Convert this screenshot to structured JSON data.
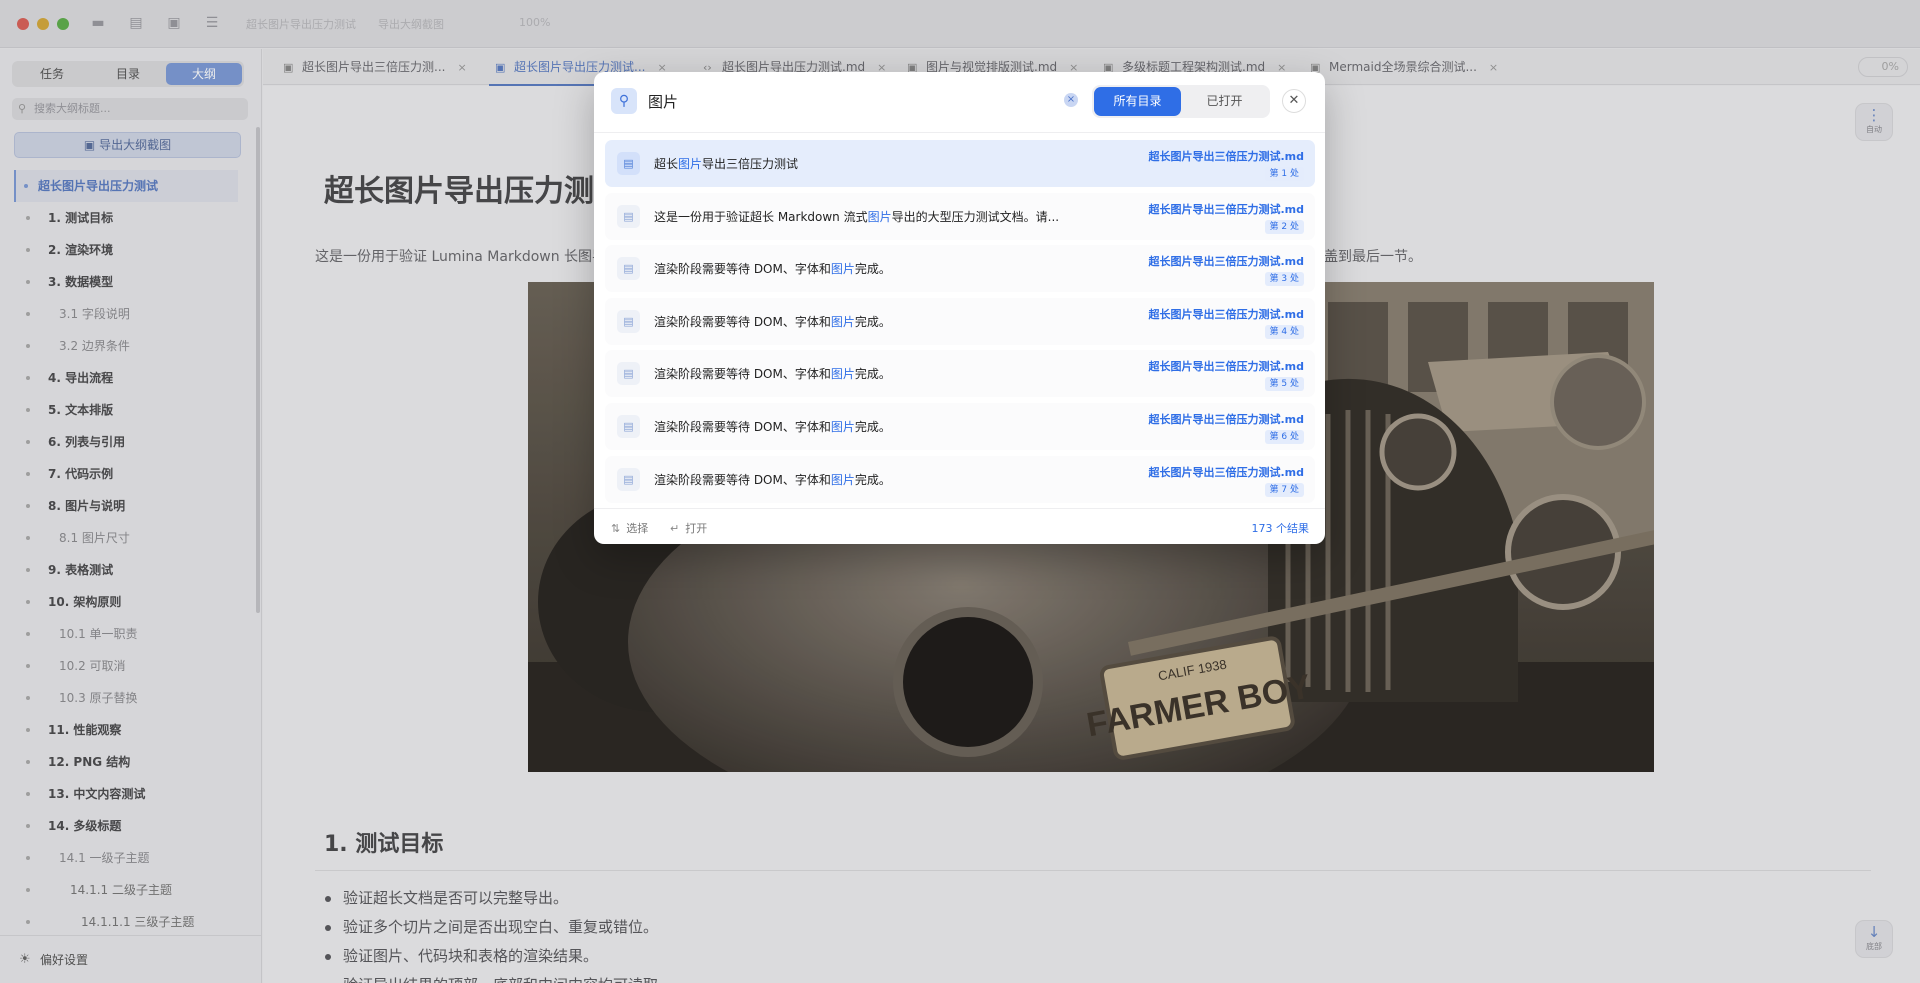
{
  "toolbar": {
    "faint_a": "超长图片导出压力测试",
    "faint_b": "导出大纲截图",
    "faint_c": "100%"
  },
  "sidebar": {
    "segments": [
      "任务",
      "目录",
      "大纲"
    ],
    "active_segment": "大纲",
    "search_placeholder": "搜索大纲标题...",
    "export_label": "导出大纲截图",
    "outline": [
      {
        "label": "超长图片导出压力测试",
        "level": 0
      },
      {
        "label": "1. 测试目标",
        "level": 1
      },
      {
        "label": "2. 渲染环境",
        "level": 1
      },
      {
        "label": "3. 数据模型",
        "level": 1
      },
      {
        "label": "3.1 字段说明",
        "level": 2
      },
      {
        "label": "3.2 边界条件",
        "level": 2
      },
      {
        "label": "4. 导出流程",
        "level": 1
      },
      {
        "label": "5. 文本排版",
        "level": 1
      },
      {
        "label": "6. 列表与引用",
        "level": 1
      },
      {
        "label": "7. 代码示例",
        "level": 1
      },
      {
        "label": "8. 图片与说明",
        "level": 1
      },
      {
        "label": "8.1 图片尺寸",
        "level": 2
      },
      {
        "label": "9. 表格测试",
        "level": 1
      },
      {
        "label": "10. 架构原则",
        "level": 1
      },
      {
        "label": "10.1 单一职责",
        "level": 2
      },
      {
        "label": "10.2 可取消",
        "level": 2
      },
      {
        "label": "10.3 原子替换",
        "level": 2
      },
      {
        "label": "11. 性能观察",
        "level": 1
      },
      {
        "label": "12. PNG 结构",
        "level": 1
      },
      {
        "label": "13. 中文内容测试",
        "level": 1
      },
      {
        "label": "14. 多级标题",
        "level": 1
      },
      {
        "label": "14.1 一级子主题",
        "level": 2
      },
      {
        "label": "14.1.1 二级子主题",
        "level": 3
      },
      {
        "label": "14.1.1.1 三级子主题",
        "level": 4
      }
    ],
    "footer_label": "偏好设置"
  },
  "tabs": [
    {
      "label": "超长图片导出三倍压力测...",
      "active": false
    },
    {
      "label": "超长图片导出压力测试...",
      "active": true
    },
    {
      "label": "超长图片导出压力测试.md",
      "active": false
    },
    {
      "label": "图片与视觉排版测试.md",
      "active": false
    },
    {
      "label": "多级标题工程架构测试.md",
      "active": false
    },
    {
      "label": "Mermaid全场景综合测试...",
      "active": false
    }
  ],
  "zoom": "0%",
  "document": {
    "title": "超长图片导出压力测",
    "intro": "这是一份用于验证 Lumina Markdown 长图导",
    "intro_tail": "覆盖到最后一节。",
    "section_heading": "1. 测试目标",
    "bullets": [
      "验证超长文档是否可以完整导出。",
      "验证多个切片之间是否出现空白、重复或错位。",
      "验证图片、代码块和表格的渲染结果。",
      "验证导出结果的顶部、底部和中间内容均可读取。"
    ],
    "image_plate_top": "CALIF 1938",
    "image_plate_main": "FARMER BOY",
    "float_top_label": "自动",
    "float_bottom_label": "底部"
  },
  "search": {
    "query": "图片",
    "scopes": [
      "所有目录",
      "已打开"
    ],
    "active_scope": "所有目录",
    "results": [
      {
        "before": "超长",
        "match": "图片",
        "after": "导出三倍压力测试",
        "file": "超长图片导出三倍压力测试.md",
        "badge": "第 1 处",
        "selected": true
      },
      {
        "before": "这是一份用于验证超长 Markdown 流式",
        "match": "图片",
        "after": "导出的大型压力测试文档。请...",
        "file": "超长图片导出三倍压力测试.md",
        "badge": "第 2 处",
        "selected": false
      },
      {
        "before": "渲染阶段需要等待 DOM、字体和",
        "match": "图片",
        "after": "完成。",
        "file": "超长图片导出三倍压力测试.md",
        "badge": "第 3 处",
        "selected": false
      },
      {
        "before": "渲染阶段需要等待 DOM、字体和",
        "match": "图片",
        "after": "完成。",
        "file": "超长图片导出三倍压力测试.md",
        "badge": "第 4 处",
        "selected": false
      },
      {
        "before": "渲染阶段需要等待 DOM、字体和",
        "match": "图片",
        "after": "完成。",
        "file": "超长图片导出三倍压力测试.md",
        "badge": "第 5 处",
        "selected": false
      },
      {
        "before": "渲染阶段需要等待 DOM、字体和",
        "match": "图片",
        "after": "完成。",
        "file": "超长图片导出三倍压力测试.md",
        "badge": "第 6 处",
        "selected": false
      },
      {
        "before": "渲染阶段需要等待 DOM、字体和",
        "match": "图片",
        "after": "完成。",
        "file": "超长图片导出三倍压力测试.md",
        "badge": "第 7 处",
        "selected": false
      }
    ],
    "footer_select": "选择",
    "footer_open": "打开",
    "result_count": "173 个结果"
  },
  "colors": {
    "accent": "#2f6ee6",
    "sidebar_accent": "#7d9bd6"
  }
}
